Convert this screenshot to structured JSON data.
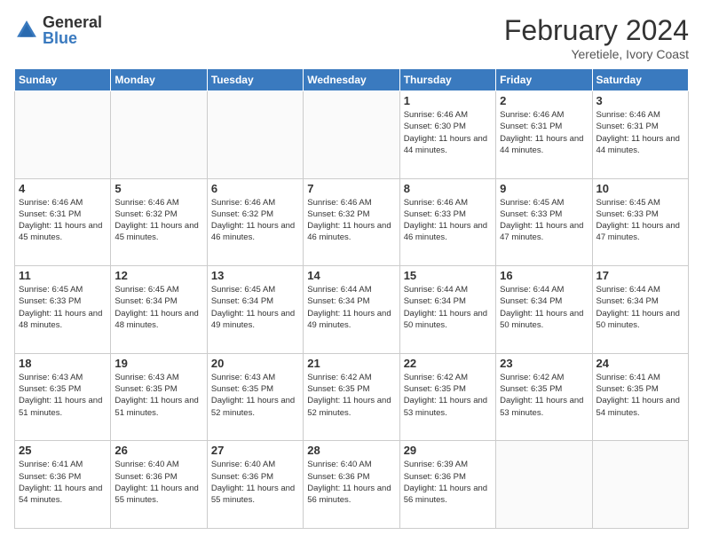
{
  "header": {
    "logo_general": "General",
    "logo_blue": "Blue",
    "title": "February 2024",
    "location": "Yeretiele, Ivory Coast"
  },
  "weekdays": [
    "Sunday",
    "Monday",
    "Tuesday",
    "Wednesday",
    "Thursday",
    "Friday",
    "Saturday"
  ],
  "weeks": [
    [
      {
        "day": "",
        "info": ""
      },
      {
        "day": "",
        "info": ""
      },
      {
        "day": "",
        "info": ""
      },
      {
        "day": "",
        "info": ""
      },
      {
        "day": "1",
        "info": "Sunrise: 6:46 AM\nSunset: 6:30 PM\nDaylight: 11 hours and 44 minutes."
      },
      {
        "day": "2",
        "info": "Sunrise: 6:46 AM\nSunset: 6:31 PM\nDaylight: 11 hours and 44 minutes."
      },
      {
        "day": "3",
        "info": "Sunrise: 6:46 AM\nSunset: 6:31 PM\nDaylight: 11 hours and 44 minutes."
      }
    ],
    [
      {
        "day": "4",
        "info": "Sunrise: 6:46 AM\nSunset: 6:31 PM\nDaylight: 11 hours and 45 minutes."
      },
      {
        "day": "5",
        "info": "Sunrise: 6:46 AM\nSunset: 6:32 PM\nDaylight: 11 hours and 45 minutes."
      },
      {
        "day": "6",
        "info": "Sunrise: 6:46 AM\nSunset: 6:32 PM\nDaylight: 11 hours and 46 minutes."
      },
      {
        "day": "7",
        "info": "Sunrise: 6:46 AM\nSunset: 6:32 PM\nDaylight: 11 hours and 46 minutes."
      },
      {
        "day": "8",
        "info": "Sunrise: 6:46 AM\nSunset: 6:33 PM\nDaylight: 11 hours and 46 minutes."
      },
      {
        "day": "9",
        "info": "Sunrise: 6:45 AM\nSunset: 6:33 PM\nDaylight: 11 hours and 47 minutes."
      },
      {
        "day": "10",
        "info": "Sunrise: 6:45 AM\nSunset: 6:33 PM\nDaylight: 11 hours and 47 minutes."
      }
    ],
    [
      {
        "day": "11",
        "info": "Sunrise: 6:45 AM\nSunset: 6:33 PM\nDaylight: 11 hours and 48 minutes."
      },
      {
        "day": "12",
        "info": "Sunrise: 6:45 AM\nSunset: 6:34 PM\nDaylight: 11 hours and 48 minutes."
      },
      {
        "day": "13",
        "info": "Sunrise: 6:45 AM\nSunset: 6:34 PM\nDaylight: 11 hours and 49 minutes."
      },
      {
        "day": "14",
        "info": "Sunrise: 6:44 AM\nSunset: 6:34 PM\nDaylight: 11 hours and 49 minutes."
      },
      {
        "day": "15",
        "info": "Sunrise: 6:44 AM\nSunset: 6:34 PM\nDaylight: 11 hours and 50 minutes."
      },
      {
        "day": "16",
        "info": "Sunrise: 6:44 AM\nSunset: 6:34 PM\nDaylight: 11 hours and 50 minutes."
      },
      {
        "day": "17",
        "info": "Sunrise: 6:44 AM\nSunset: 6:34 PM\nDaylight: 11 hours and 50 minutes."
      }
    ],
    [
      {
        "day": "18",
        "info": "Sunrise: 6:43 AM\nSunset: 6:35 PM\nDaylight: 11 hours and 51 minutes."
      },
      {
        "day": "19",
        "info": "Sunrise: 6:43 AM\nSunset: 6:35 PM\nDaylight: 11 hours and 51 minutes."
      },
      {
        "day": "20",
        "info": "Sunrise: 6:43 AM\nSunset: 6:35 PM\nDaylight: 11 hours and 52 minutes."
      },
      {
        "day": "21",
        "info": "Sunrise: 6:42 AM\nSunset: 6:35 PM\nDaylight: 11 hours and 52 minutes."
      },
      {
        "day": "22",
        "info": "Sunrise: 6:42 AM\nSunset: 6:35 PM\nDaylight: 11 hours and 53 minutes."
      },
      {
        "day": "23",
        "info": "Sunrise: 6:42 AM\nSunset: 6:35 PM\nDaylight: 11 hours and 53 minutes."
      },
      {
        "day": "24",
        "info": "Sunrise: 6:41 AM\nSunset: 6:35 PM\nDaylight: 11 hours and 54 minutes."
      }
    ],
    [
      {
        "day": "25",
        "info": "Sunrise: 6:41 AM\nSunset: 6:36 PM\nDaylight: 11 hours and 54 minutes."
      },
      {
        "day": "26",
        "info": "Sunrise: 6:40 AM\nSunset: 6:36 PM\nDaylight: 11 hours and 55 minutes."
      },
      {
        "day": "27",
        "info": "Sunrise: 6:40 AM\nSunset: 6:36 PM\nDaylight: 11 hours and 55 minutes."
      },
      {
        "day": "28",
        "info": "Sunrise: 6:40 AM\nSunset: 6:36 PM\nDaylight: 11 hours and 56 minutes."
      },
      {
        "day": "29",
        "info": "Sunrise: 6:39 AM\nSunset: 6:36 PM\nDaylight: 11 hours and 56 minutes."
      },
      {
        "day": "",
        "info": ""
      },
      {
        "day": "",
        "info": ""
      }
    ]
  ]
}
